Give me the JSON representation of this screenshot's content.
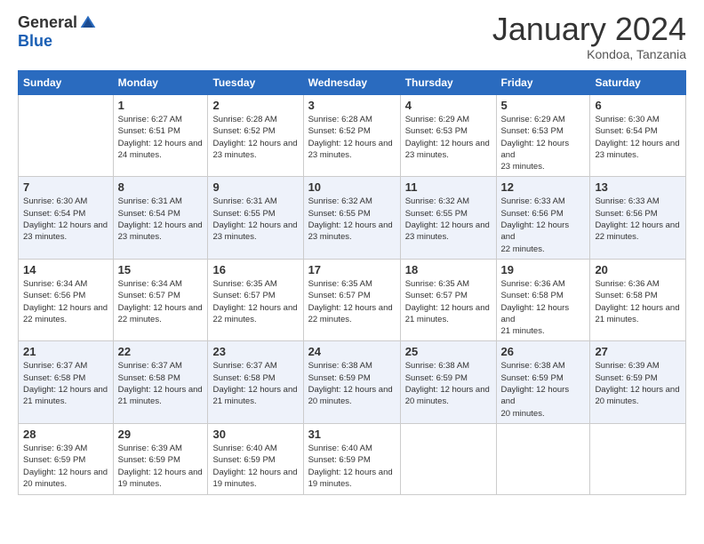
{
  "header": {
    "logo_general": "General",
    "logo_blue": "Blue",
    "month_title": "January 2024",
    "subtitle": "Kondoa, Tanzania"
  },
  "days_of_week": [
    "Sunday",
    "Monday",
    "Tuesday",
    "Wednesday",
    "Thursday",
    "Friday",
    "Saturday"
  ],
  "weeks": [
    [
      {
        "day": "",
        "sunrise": "",
        "sunset": "",
        "daylight": ""
      },
      {
        "day": "1",
        "sunrise": "Sunrise: 6:27 AM",
        "sunset": "Sunset: 6:51 PM",
        "daylight": "Daylight: 12 hours and 24 minutes."
      },
      {
        "day": "2",
        "sunrise": "Sunrise: 6:28 AM",
        "sunset": "Sunset: 6:52 PM",
        "daylight": "Daylight: 12 hours and 23 minutes."
      },
      {
        "day": "3",
        "sunrise": "Sunrise: 6:28 AM",
        "sunset": "Sunset: 6:52 PM",
        "daylight": "Daylight: 12 hours and 23 minutes."
      },
      {
        "day": "4",
        "sunrise": "Sunrise: 6:29 AM",
        "sunset": "Sunset: 6:53 PM",
        "daylight": "Daylight: 12 hours and 23 minutes."
      },
      {
        "day": "5",
        "sunrise": "Sunrise: 6:29 AM",
        "sunset": "Sunset: 6:53 PM",
        "daylight": "Daylight: 12 hours and 23 minutes."
      },
      {
        "day": "6",
        "sunrise": "Sunrise: 6:30 AM",
        "sunset": "Sunset: 6:54 PM",
        "daylight": "Daylight: 12 hours and 23 minutes."
      }
    ],
    [
      {
        "day": "7",
        "sunrise": "Sunrise: 6:30 AM",
        "sunset": "Sunset: 6:54 PM",
        "daylight": "Daylight: 12 hours and 23 minutes."
      },
      {
        "day": "8",
        "sunrise": "Sunrise: 6:31 AM",
        "sunset": "Sunset: 6:54 PM",
        "daylight": "Daylight: 12 hours and 23 minutes."
      },
      {
        "day": "9",
        "sunrise": "Sunrise: 6:31 AM",
        "sunset": "Sunset: 6:55 PM",
        "daylight": "Daylight: 12 hours and 23 minutes."
      },
      {
        "day": "10",
        "sunrise": "Sunrise: 6:32 AM",
        "sunset": "Sunset: 6:55 PM",
        "daylight": "Daylight: 12 hours and 23 minutes."
      },
      {
        "day": "11",
        "sunrise": "Sunrise: 6:32 AM",
        "sunset": "Sunset: 6:55 PM",
        "daylight": "Daylight: 12 hours and 23 minutes."
      },
      {
        "day": "12",
        "sunrise": "Sunrise: 6:33 AM",
        "sunset": "Sunset: 6:56 PM",
        "daylight": "Daylight: 12 hours and 22 minutes."
      },
      {
        "day": "13",
        "sunrise": "Sunrise: 6:33 AM",
        "sunset": "Sunset: 6:56 PM",
        "daylight": "Daylight: 12 hours and 22 minutes."
      }
    ],
    [
      {
        "day": "14",
        "sunrise": "Sunrise: 6:34 AM",
        "sunset": "Sunset: 6:56 PM",
        "daylight": "Daylight: 12 hours and 22 minutes."
      },
      {
        "day": "15",
        "sunrise": "Sunrise: 6:34 AM",
        "sunset": "Sunset: 6:57 PM",
        "daylight": "Daylight: 12 hours and 22 minutes."
      },
      {
        "day": "16",
        "sunrise": "Sunrise: 6:35 AM",
        "sunset": "Sunset: 6:57 PM",
        "daylight": "Daylight: 12 hours and 22 minutes."
      },
      {
        "day": "17",
        "sunrise": "Sunrise: 6:35 AM",
        "sunset": "Sunset: 6:57 PM",
        "daylight": "Daylight: 12 hours and 22 minutes."
      },
      {
        "day": "18",
        "sunrise": "Sunrise: 6:35 AM",
        "sunset": "Sunset: 6:57 PM",
        "daylight": "Daylight: 12 hours and 21 minutes."
      },
      {
        "day": "19",
        "sunrise": "Sunrise: 6:36 AM",
        "sunset": "Sunset: 6:58 PM",
        "daylight": "Daylight: 12 hours and 21 minutes."
      },
      {
        "day": "20",
        "sunrise": "Sunrise: 6:36 AM",
        "sunset": "Sunset: 6:58 PM",
        "daylight": "Daylight: 12 hours and 21 minutes."
      }
    ],
    [
      {
        "day": "21",
        "sunrise": "Sunrise: 6:37 AM",
        "sunset": "Sunset: 6:58 PM",
        "daylight": "Daylight: 12 hours and 21 minutes."
      },
      {
        "day": "22",
        "sunrise": "Sunrise: 6:37 AM",
        "sunset": "Sunset: 6:58 PM",
        "daylight": "Daylight: 12 hours and 21 minutes."
      },
      {
        "day": "23",
        "sunrise": "Sunrise: 6:37 AM",
        "sunset": "Sunset: 6:58 PM",
        "daylight": "Daylight: 12 hours and 21 minutes."
      },
      {
        "day": "24",
        "sunrise": "Sunrise: 6:38 AM",
        "sunset": "Sunset: 6:59 PM",
        "daylight": "Daylight: 12 hours and 20 minutes."
      },
      {
        "day": "25",
        "sunrise": "Sunrise: 6:38 AM",
        "sunset": "Sunset: 6:59 PM",
        "daylight": "Daylight: 12 hours and 20 minutes."
      },
      {
        "day": "26",
        "sunrise": "Sunrise: 6:38 AM",
        "sunset": "Sunset: 6:59 PM",
        "daylight": "Daylight: 12 hours and 20 minutes."
      },
      {
        "day": "27",
        "sunrise": "Sunrise: 6:39 AM",
        "sunset": "Sunset: 6:59 PM",
        "daylight": "Daylight: 12 hours and 20 minutes."
      }
    ],
    [
      {
        "day": "28",
        "sunrise": "Sunrise: 6:39 AM",
        "sunset": "Sunset: 6:59 PM",
        "daylight": "Daylight: 12 hours and 20 minutes."
      },
      {
        "day": "29",
        "sunrise": "Sunrise: 6:39 AM",
        "sunset": "Sunset: 6:59 PM",
        "daylight": "Daylight: 12 hours and 19 minutes."
      },
      {
        "day": "30",
        "sunrise": "Sunrise: 6:40 AM",
        "sunset": "Sunset: 6:59 PM",
        "daylight": "Daylight: 12 hours and 19 minutes."
      },
      {
        "day": "31",
        "sunrise": "Sunrise: 6:40 AM",
        "sunset": "Sunset: 6:59 PM",
        "daylight": "Daylight: 12 hours and 19 minutes."
      },
      {
        "day": "",
        "sunrise": "",
        "sunset": "",
        "daylight": ""
      },
      {
        "day": "",
        "sunrise": "",
        "sunset": "",
        "daylight": ""
      },
      {
        "day": "",
        "sunrise": "",
        "sunset": "",
        "daylight": ""
      }
    ]
  ]
}
